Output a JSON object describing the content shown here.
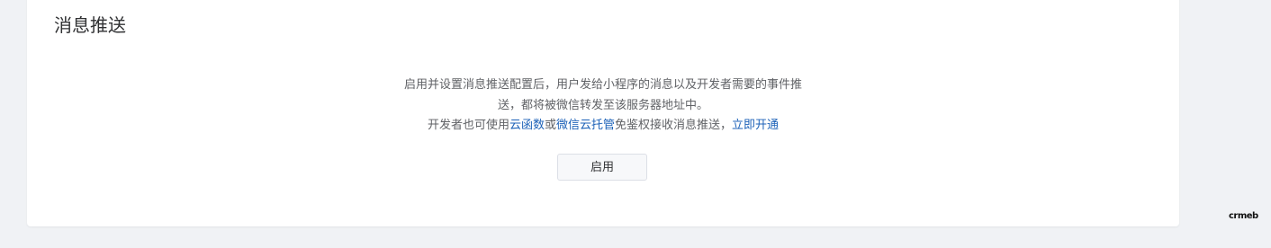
{
  "card": {
    "title": "消息推送",
    "desc_line1": "启用并设置消息推送配置后，用户发给小程序的消息以及开发者需要的事件推",
    "desc_line2": "送，都将被微信转发至该服务器地址中。",
    "desc_line3_prefix": "开发者也可使用",
    "link_cloud_function": "云函数",
    "desc_or": "或",
    "link_wechat_cloud": "微信云托管",
    "desc_line3_suffix": "免鉴权接收消息推送，",
    "link_activate": "立即开通",
    "enable_button_label": "启用"
  },
  "brand_logo": "crmeb"
}
